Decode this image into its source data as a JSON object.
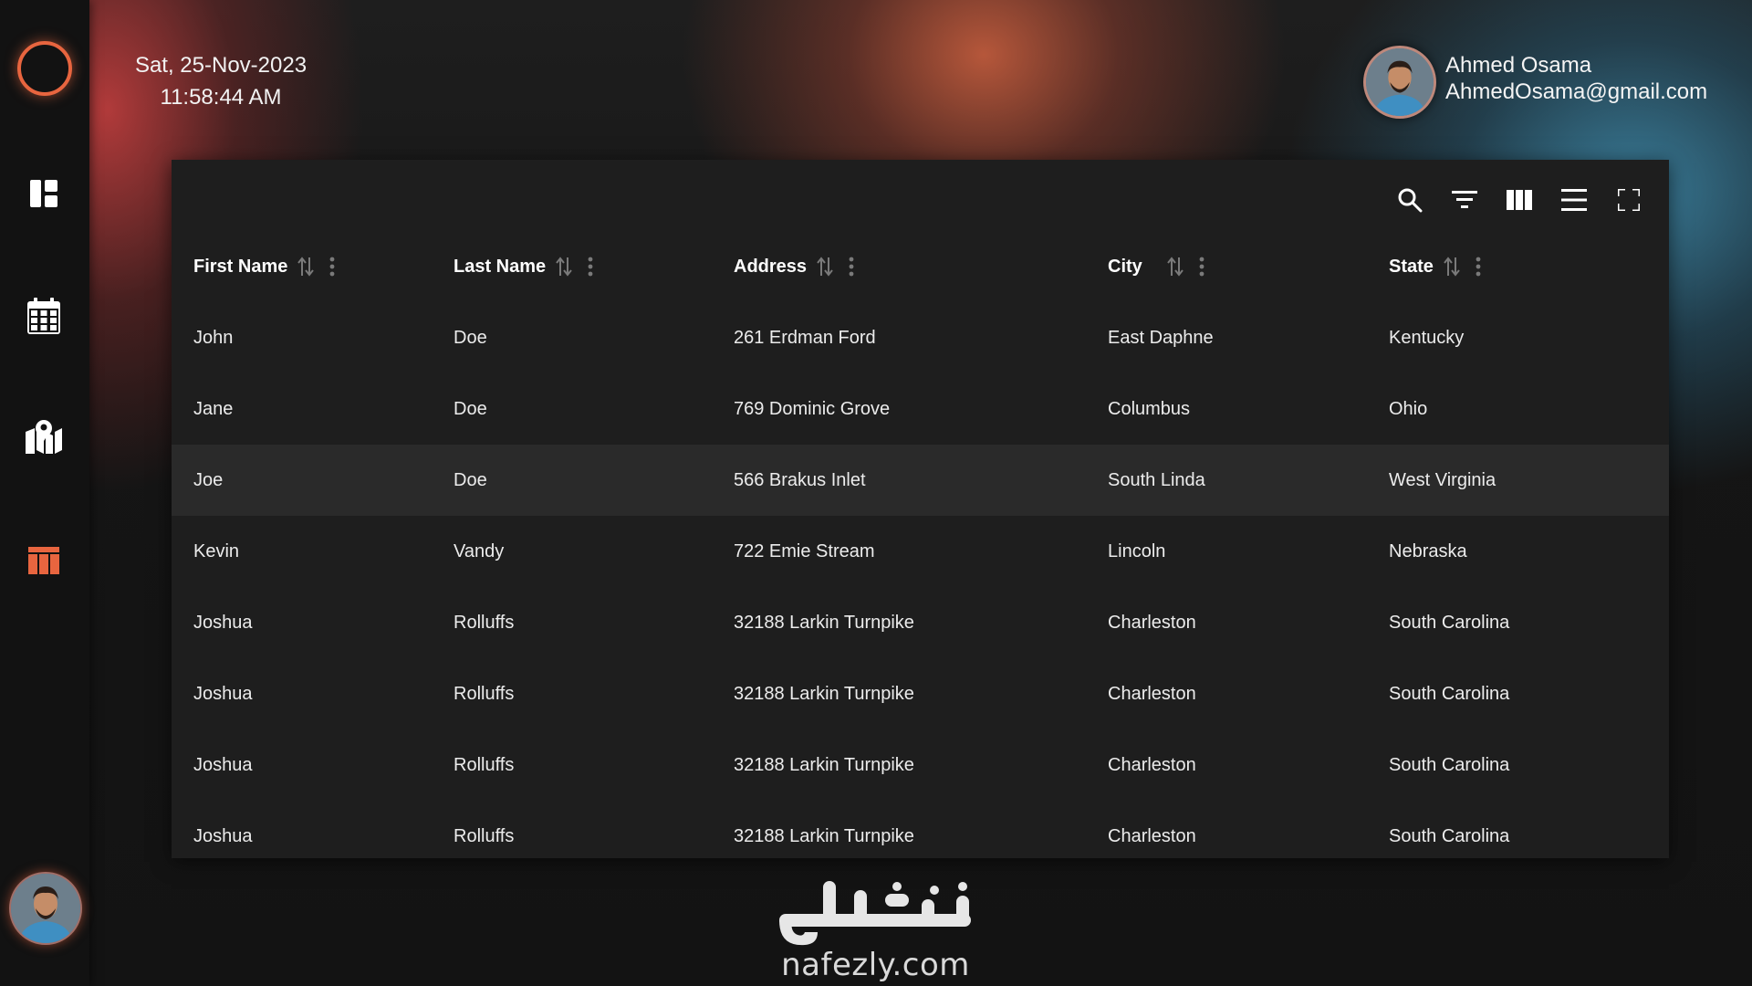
{
  "header": {
    "date": "Sat, 25-Nov-2023",
    "time": "11:58:44 AM"
  },
  "user": {
    "name": "Ahmed Osama",
    "email": "AhmedOsama@gmail.com"
  },
  "sidebar": {
    "items": [
      {
        "name": "dashboard",
        "icon": "dashboard-icon"
      },
      {
        "name": "calendar",
        "icon": "calendar-icon"
      },
      {
        "name": "map",
        "icon": "map-icon"
      },
      {
        "name": "table",
        "icon": "table-icon",
        "active": true
      }
    ],
    "accent": "#e8653f"
  },
  "toolbar": {
    "icons": [
      "search-icon",
      "filter-icon",
      "columns-icon",
      "density-icon",
      "fullscreen-icon"
    ]
  },
  "table": {
    "columns": [
      "First Name",
      "Last Name",
      "Address",
      "City",
      "State"
    ],
    "rows": [
      [
        "John",
        "Doe",
        "261 Erdman Ford",
        "East Daphne",
        "Kentucky"
      ],
      [
        "Jane",
        "Doe",
        "769 Dominic Grove",
        "Columbus",
        "Ohio"
      ],
      [
        "Joe",
        "Doe",
        "566 Brakus Inlet",
        "South Linda",
        "West Virginia"
      ],
      [
        "Kevin",
        "Vandy",
        "722 Emie Stream",
        "Lincoln",
        "Nebraska"
      ],
      [
        "Joshua",
        "Rolluffs",
        "32188 Larkin Turnpike",
        "Charleston",
        "South Carolina"
      ],
      [
        "Joshua",
        "Rolluffs",
        "32188 Larkin Turnpike",
        "Charleston",
        "South Carolina"
      ],
      [
        "Joshua",
        "Rolluffs",
        "32188 Larkin Turnpike",
        "Charleston",
        "South Carolina"
      ],
      [
        "Joshua",
        "Rolluffs",
        "32188 Larkin Turnpike",
        "Charleston",
        "South Carolina"
      ]
    ],
    "highlighted_row": 2
  },
  "watermark": {
    "arabic": "نفذلي",
    "domain": "nafezly.com"
  }
}
